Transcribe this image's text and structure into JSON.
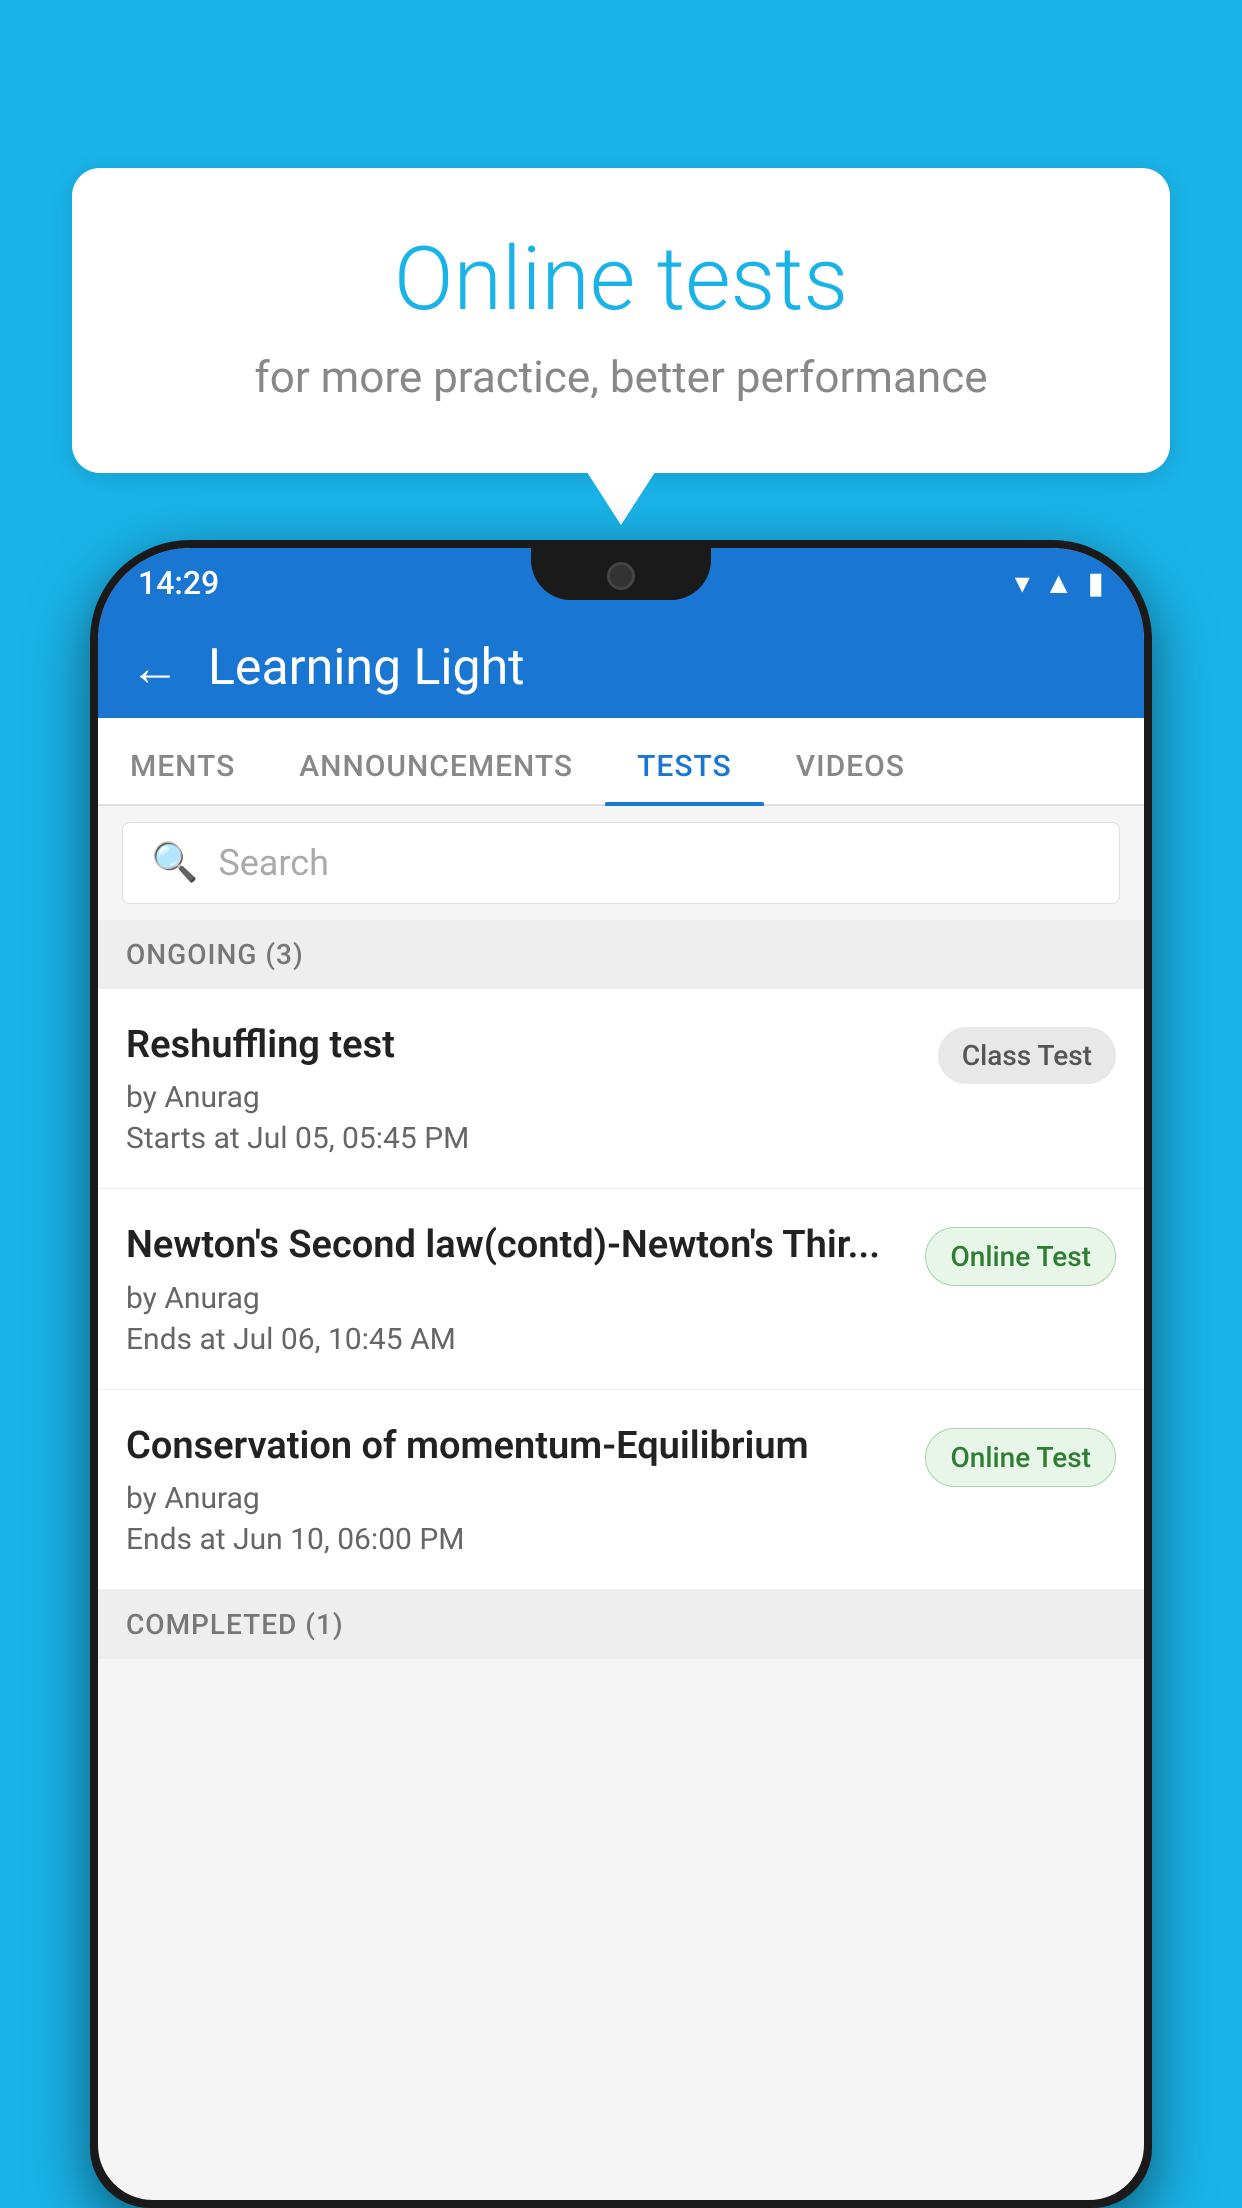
{
  "background_color": "#1ab3e8",
  "speech_bubble": {
    "title": "Online tests",
    "subtitle": "for more practice, better performance"
  },
  "phone": {
    "status_bar": {
      "time": "14:29",
      "icons": [
        "wifi",
        "signal",
        "battery"
      ]
    },
    "app_bar": {
      "title": "Learning Light",
      "back_label": "←"
    },
    "tabs": [
      {
        "label": "MENTS",
        "active": false
      },
      {
        "label": "ANNOUNCEMENTS",
        "active": false
      },
      {
        "label": "TESTS",
        "active": true
      },
      {
        "label": "VIDEOS",
        "active": false
      }
    ],
    "search": {
      "placeholder": "Search"
    },
    "ongoing_section": {
      "header": "ONGOING (3)",
      "items": [
        {
          "name": "Reshuffling test",
          "by": "by Anurag",
          "date": "Starts at  Jul 05, 05:45 PM",
          "badge": "Class Test",
          "badge_type": "class"
        },
        {
          "name": "Newton's Second law(contd)-Newton's Thir...",
          "by": "by Anurag",
          "date": "Ends at  Jul 06, 10:45 AM",
          "badge": "Online Test",
          "badge_type": "online"
        },
        {
          "name": "Conservation of momentum-Equilibrium",
          "by": "by Anurag",
          "date": "Ends at  Jun 10, 06:00 PM",
          "badge": "Online Test",
          "badge_type": "online"
        }
      ]
    },
    "completed_section": {
      "header": "COMPLETED (1)"
    }
  }
}
